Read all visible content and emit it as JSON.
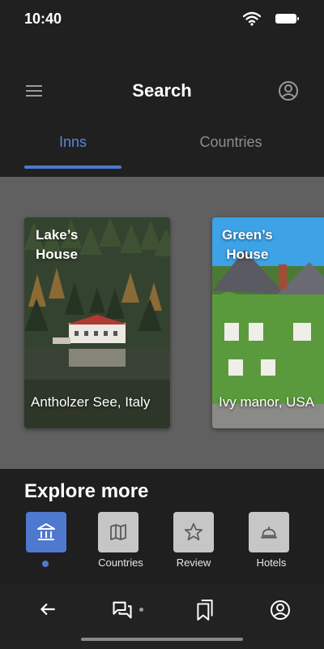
{
  "status_bar": {
    "time": "10:40",
    "icons": [
      "wifi-icon",
      "battery-icon"
    ]
  },
  "app_bar": {
    "title": "Search",
    "left_icon": "menu-icon",
    "right_icon": "account-icon"
  },
  "tabs": [
    {
      "label": "Inns",
      "selected": true
    },
    {
      "label": "Countries",
      "selected": false
    }
  ],
  "cards": [
    {
      "title": "Lake’s\nHouse",
      "subtitle": "Antholzer See, Italy",
      "image": "lake-house-photo"
    },
    {
      "title": "Green’s\nHouse",
      "subtitle": "Ivy manor, USA",
      "image": "ivy-manor-photo"
    }
  ],
  "explore": {
    "title": "Explore more",
    "items": [
      {
        "label": "",
        "icon": "bank-icon",
        "selected": true
      },
      {
        "label": "Countries",
        "icon": "map-icon",
        "selected": false
      },
      {
        "label": "Review",
        "icon": "star-icon",
        "selected": false
      },
      {
        "label": "Hotels",
        "icon": "room-service-icon",
        "selected": false
      }
    ]
  },
  "bottom_nav": {
    "icons": [
      "back-arrow-icon",
      "chat-icon",
      "bookmarks-icon",
      "account-icon"
    ]
  },
  "colors": {
    "accent": "#4f78cf",
    "background": "#202020",
    "carousel_bg": "#606060",
    "chip_bg": "#c6c6c6",
    "inactive_tab": "#8e8e8e"
  }
}
